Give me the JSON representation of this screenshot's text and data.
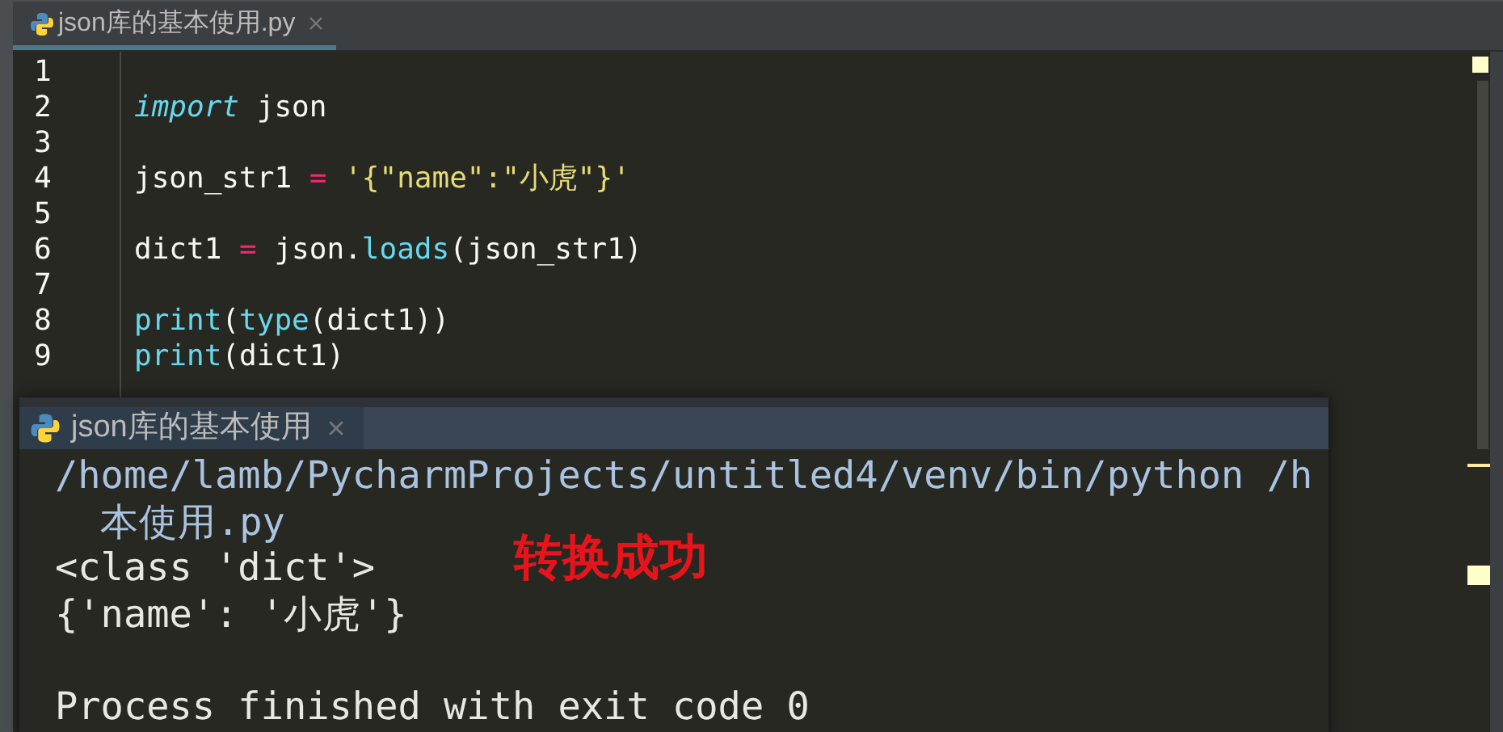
{
  "editor_tabs": [
    {
      "label": "json库的基本使用.py",
      "selected": true
    }
  ],
  "code_lines": [
    {
      "number": "1"
    },
    {
      "number": "2",
      "tokens": [
        {
          "kind": "keyword",
          "text": "import"
        },
        {
          "kind": "plain",
          "text": " json"
        }
      ]
    },
    {
      "number": "3"
    },
    {
      "number": "4",
      "tokens": [
        {
          "kind": "plain",
          "text": "json_str1 "
        },
        {
          "kind": "operator",
          "text": "= "
        },
        {
          "kind": "string",
          "text": "'{\"name\":\"小虎\"}'"
        }
      ]
    },
    {
      "number": "5"
    },
    {
      "number": "6",
      "tokens": [
        {
          "kind": "plain",
          "text": "dict1 "
        },
        {
          "kind": "operator",
          "text": "="
        },
        {
          "kind": "plain",
          "text": " json."
        },
        {
          "kind": "function",
          "text": "loads"
        },
        {
          "kind": "plain",
          "text": "(json_str1)"
        }
      ]
    },
    {
      "number": "7"
    },
    {
      "number": "8",
      "tokens": [
        {
          "kind": "function",
          "text": "print"
        },
        {
          "kind": "plain",
          "text": "("
        },
        {
          "kind": "function",
          "text": "type"
        },
        {
          "kind": "plain",
          "text": "(dict1))"
        }
      ]
    },
    {
      "number": "9",
      "tokens": [
        {
          "kind": "function",
          "text": "print"
        },
        {
          "kind": "plain",
          "text": "(dict1)"
        }
      ]
    }
  ],
  "run_panel": {
    "tab": {
      "label": "json库的基本使用",
      "selected": true
    },
    "output": [
      {
        "kind": "command",
        "text": "/home/lamb/PycharmProjects/untitled4/venv/bin/python /h"
      },
      {
        "kind": "continuation",
        "text": "本使用.py"
      },
      {
        "kind": "output",
        "text": "<class 'dict'>"
      },
      {
        "kind": "output",
        "text": "{'name': '小虎'}"
      },
      {
        "kind": "blank"
      },
      {
        "kind": "output",
        "text": "Process finished with exit code 0"
      }
    ],
    "annotation": "转换成功"
  }
}
